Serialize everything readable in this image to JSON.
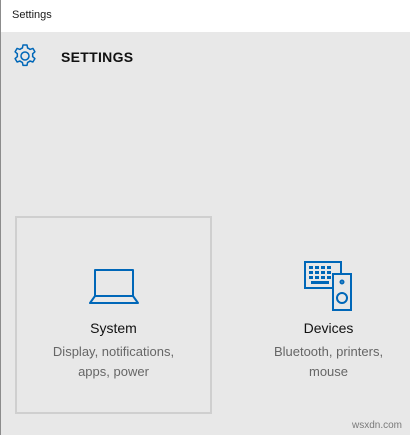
{
  "window": {
    "title": "Settings"
  },
  "header": {
    "title": "SETTINGS",
    "icon": "gear-icon"
  },
  "tiles": [
    {
      "title": "System",
      "desc_line1": "Display, notifications,",
      "desc_line2": "apps, power",
      "icon": "laptop-icon"
    },
    {
      "title": "Devices",
      "desc_line1": "Bluetooth, printers,",
      "desc_line2": "mouse",
      "icon": "keyboard-speaker-icon"
    }
  ],
  "watermark": "wsxdn.com",
  "colors": {
    "accent": "#0067b8",
    "background": "#e8e8e8",
    "selected_border": "#cfcfcf"
  }
}
